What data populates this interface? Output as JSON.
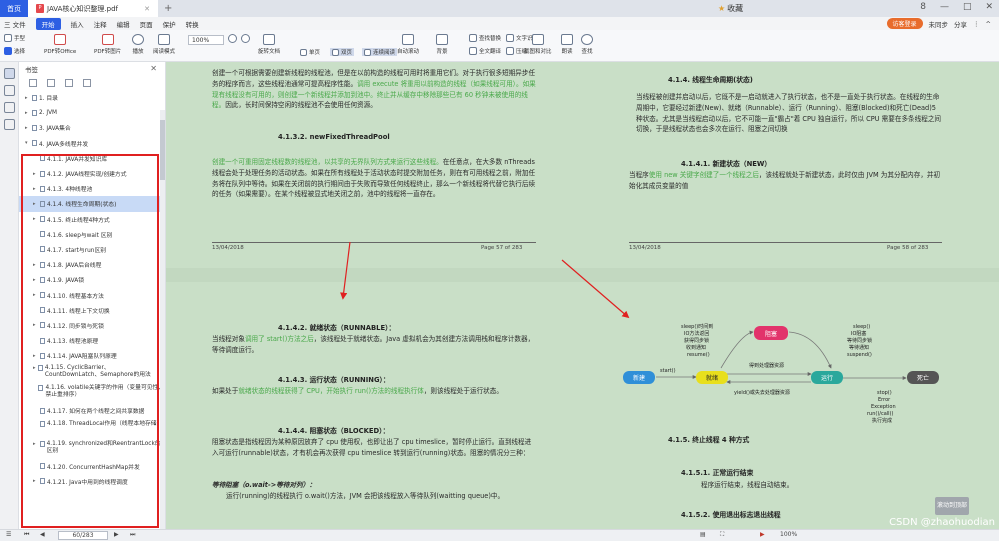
{
  "tabs": {
    "home": "首页",
    "file": "JAVA核心知识整理.pdf",
    "add": "+"
  },
  "favorites": "收藏",
  "window_controls": [
    "8",
    "—",
    "□",
    "✕"
  ],
  "menu": {
    "items": [
      "三 文件",
      "开始",
      "插入",
      "注释",
      "编辑",
      "页面",
      "保护",
      "转换"
    ],
    "active": "开始",
    "right": [
      "访客登录",
      "未同步",
      "分享",
      "⋮",
      "^"
    ]
  },
  "toolbar": {
    "buttons": [
      "手型",
      "选择",
      "PDF转Office",
      "PDF转图片",
      "播放",
      "阅读模式",
      "旋转文档",
      "单页",
      "双页",
      "连续阅读",
      "自动滚动",
      "背景",
      "全文翻译",
      "压缩",
      "截图和对比",
      "朗读",
      "查找"
    ],
    "zoom": "100%",
    "extra": [
      "查找替换",
      "文字识别"
    ]
  },
  "outline": {
    "title": "书签",
    "close": "✕",
    "items": [
      {
        "arrow": "▸",
        "text": "1. 目录",
        "level": 0
      },
      {
        "arrow": "▸",
        "text": "2. JVM",
        "level": 0
      },
      {
        "arrow": "▸",
        "text": "3. JAVA集合",
        "level": 0
      },
      {
        "arrow": "▾",
        "text": "4. JAVA多线程并发",
        "level": 0
      },
      {
        "arrow": "",
        "text": "4.1.1. JAVA并发知识库",
        "level": 1
      },
      {
        "arrow": "▸",
        "text": "4.1.2. JAVA线程实现/创建方式",
        "level": 1
      },
      {
        "arrow": "▸",
        "text": "4.1.3. 4种线程池",
        "level": 1
      },
      {
        "arrow": "▸",
        "text": "4.1.4. 线程生命周期(状态)",
        "level": 1,
        "selected": true
      },
      {
        "arrow": "▸",
        "text": "4.1.5. 终止线程4种方式",
        "level": 1
      },
      {
        "arrow": "",
        "text": "4.1.6. sleep与wait 区别",
        "level": 1
      },
      {
        "arrow": "",
        "text": "4.1.7. start与run区别",
        "level": 1
      },
      {
        "arrow": "▸",
        "text": "4.1.8. JAVA后台线程",
        "level": 1
      },
      {
        "arrow": "▸",
        "text": "4.1.9. JAVA锁",
        "level": 1
      },
      {
        "arrow": "▸",
        "text": "4.1.10. 线程基本方法",
        "level": 1
      },
      {
        "arrow": "",
        "text": "4.1.11. 线程上下文切换",
        "level": 1
      },
      {
        "arrow": "▸",
        "text": "4.1.12. 同步锁与死锁",
        "level": 1
      },
      {
        "arrow": "",
        "text": "4.1.13. 线程池原理",
        "level": 1
      },
      {
        "arrow": "▸",
        "text": "4.1.14. JAVA阻塞队列原理",
        "level": 1
      },
      {
        "arrow": "▸",
        "text": "4.1.15. CyclicBarrier、CountDownLatch、Semaphore的用法",
        "level": 1,
        "wrap": true
      },
      {
        "arrow": "",
        "text": "4.1.16. volatile关键字的作用（变量可见性、禁止重排序）",
        "level": 1,
        "wrap": true
      },
      {
        "arrow": "",
        "text": "4.1.17. 如何在两个线程之间共享数据",
        "level": 1
      },
      {
        "arrow": "",
        "text": "4.1.18. ThreadLocal作用（线程本地存储）",
        "level": 1,
        "wrap": true
      },
      {
        "arrow": "▸",
        "text": "4.1.19. synchronized和ReentrantLock的区别",
        "level": 1,
        "wrap": true
      },
      {
        "arrow": "",
        "text": "4.1.20. ConcurrentHashMap并发",
        "level": 1
      },
      {
        "arrow": "▸",
        "text": "4.1.21. Java中用到的线程调度",
        "level": 1
      }
    ]
  },
  "page57": {
    "intro_parts": [
      "创建一个可根据需要创建新线程的线程池，但是在以前构造的线程可用时将重用它们。对于执行很多短期异步任务的程序而言，这些线程池通常可提高程序性能。",
      "调用 execute 将重用以前构造的线程（如果线程可用）。如果现有线程没有可用的，则创建一个新线程并添加到池中。终止并从缓存中移除那些已有 60 秒钟未被使用的线程。",
      "因此，长时间保持空闲的线程池不会使用任何资源。"
    ],
    "heading": "4.1.3.2.      newFixedThreadPool",
    "body_parts": [
      "创建一个可重用固定线程数的线程池，以共享的无界队列方式来运行这些线程。",
      "在任意点，在大多数 nThreads 线程会处于处理任务的活动状态。如果在所有线程处于活动状态时提交附加任务，则在有可用线程之前，附加任务将在队列中等待。如果在关闭前的执行期间由于失败而导致任何线程终止，那么一个新线程将代替它执行后续的任务（如果需要）。在某个线程被显式地关闭之前，池中的线程将一直存在。"
    ],
    "date": "13/04/2018",
    "pageno": "Page 57 of 283"
  },
  "page58": {
    "heading": "4.1.4.    线程生命周期(状态)",
    "body": "当线程被创建并启动以后，它既不是一启动就进入了执行状态，也不是一直处于执行状态。在线程的生命周期中，它要经过新建(New)、就绪（Runnable）、运行（Running）、阻塞(Blocked)和死亡(Dead)5 种状态。尤其是当线程启动以后，它不可能一直\"霸占\"着 CPU 独自运行，所以 CPU 需要在多条线程之间切换，于是线程状态也会多次在运行、阻塞之间切换",
    "sub_heading": "4.1.4.1.      新建状态（NEW）",
    "sub_parts": [
      "当程序",
      "使用 new 关键字创建了一个线程之后",
      "，该线程就处于新建状态，此时仅由 JVM 为其分配内存，并初始化其成员变量的值"
    ],
    "date": "13/04/2018",
    "pageno": "Page 58 of 283"
  },
  "page59": {
    "h_runnable": "4.1.4.2.      就绪状态（RUNNABLE）：",
    "runnable_parts": [
      "当线程对象",
      "调用了 start()方法之后",
      "，该线程处于就绪状态。Java 虚拟机会为其创建方法调用栈和程序计数器，等待调度运行。"
    ],
    "h_running": "4.1.4.3.      运行状态（RUNNING）：",
    "running_parts": [
      "如果处于",
      "就绪状态的线程获得了 CPU，开始执行 run()方法的线程执行体",
      "，则该线程处于运行状态。"
    ],
    "h_blocked": "4.1.4.4.      阻塞状态（BLOCKED）：",
    "blocked_body": "阻塞状态是指线程因为某种原因放弃了 cpu 使用权，也即让出了 cpu timeslice，暂时停止运行。直到线程进入可运行(runnable)状态，才有机会再次获得 cpu timeslice 转到运行(running)状态。阻塞的情况分三种：",
    "wait_title": "等待阻塞（o.wait->等待对列）：",
    "wait_body": "运行(running)的线程执行 o.wait()方法，JVM 会把该线程放入等待队列(waitting queue)中。"
  },
  "page60": {
    "diagram": {
      "states": [
        "新建",
        "就绪",
        "运行",
        "阻塞",
        "死亡"
      ],
      "left_notes": [
        "sleep()时间到",
        "IO方法返回",
        "获得同步锁",
        "收到通知",
        "resume()"
      ],
      "right_notes": [
        "sleep()",
        "IO阻塞",
        "等待同步锁",
        "等待通知",
        "suspend()"
      ],
      "start_label": "start()",
      "middle_label": "得到处理器资源",
      "yield_label": "yield()或失去处理器资源",
      "end_notes": [
        "stop()",
        "Error",
        "Exception",
        "run()/call()",
        "执行完成"
      ]
    },
    "h_stop": "4.1.5.    终止线程 4 种方式",
    "h_normal": "4.1.5.1.      正常运行结束",
    "normal_body": "程序运行结束，线程自动结束。",
    "h_flag": "4.1.5.2.      使用退出标志退出线程"
  },
  "scroll_top": "滚动到顶部",
  "status": {
    "page": "60",
    "page_total": "/283",
    "zoom": "100%"
  },
  "watermark": "CSDN @zhaohuodian"
}
